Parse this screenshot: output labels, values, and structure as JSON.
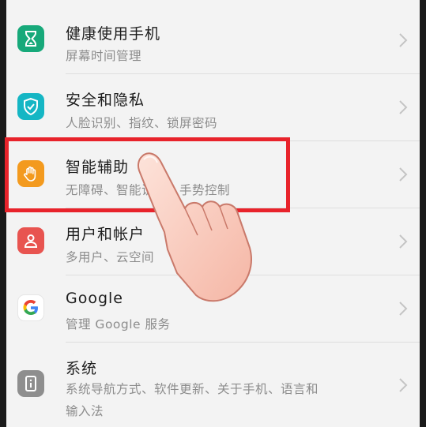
{
  "settings": {
    "items": [
      {
        "title": "健康使用手机",
        "subtitle": "屏幕时间管理",
        "icon": "hourglass-icon",
        "color": "#17a97a"
      },
      {
        "title": "安全和隐私",
        "subtitle": "人脸识别、指纹、锁屏密码",
        "icon": "shield-check-icon",
        "color": "#15b6c4"
      },
      {
        "title": "智能辅助",
        "subtitle": "无障碍、智能识屏、手势控制",
        "icon": "hand-icon",
        "color": "#f39a1e"
      },
      {
        "title": "用户和帐户",
        "subtitle": "多用户、云空间",
        "icon": "user-icon",
        "color": "#e85450"
      },
      {
        "title": "Google",
        "subtitle": "管理 Google 服务",
        "icon": "google-icon",
        "color": "#ffffff"
      },
      {
        "title": "系统",
        "subtitle": "系统导航方式、软件更新、关于手机、语言和",
        "subtitle2": "输入法",
        "icon": "info-icon",
        "color": "#8e8e8e"
      }
    ]
  },
  "annotation": {
    "highlight_color": "#e8232b"
  }
}
